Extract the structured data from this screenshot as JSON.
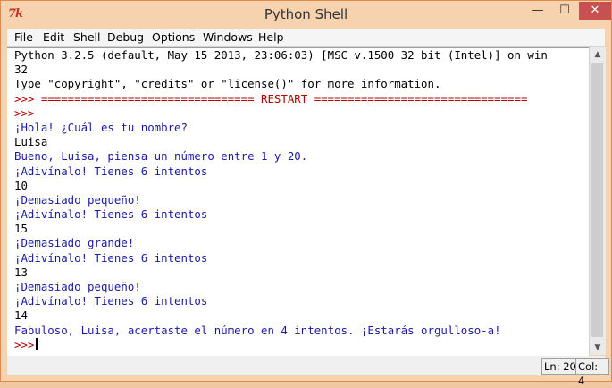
{
  "window": {
    "title": "Python Shell",
    "icon_text": "7k",
    "controls": {
      "minimize": "—",
      "maximize": "☐",
      "close": "✕"
    }
  },
  "menu": [
    "File",
    "Edit",
    "Shell",
    "Debug",
    "Options",
    "Windows",
    "Help"
  ],
  "shell_lines": [
    {
      "text": "Python 3.2.5 (default, May 15 2013, 23:06:03) [MSC v.1500 32 bit (Intel)] on win",
      "color": "black"
    },
    {
      "text": "32",
      "color": "black"
    },
    {
      "text": "Type \"copyright\", \"credits\" or \"license()\" for more information.",
      "color": "black"
    },
    {
      "text": ">>> ================================ RESTART ================================",
      "color": "red"
    },
    {
      "text": ">>>",
      "color": "red"
    },
    {
      "text": "¡Hola! ¿Cuál es tu nombre?",
      "color": "blue"
    },
    {
      "text": "Luisa",
      "color": "black"
    },
    {
      "text": "Bueno, Luisa, piensa un número entre 1 y 20.",
      "color": "blue"
    },
    {
      "text": "¡Adivínalo! Tienes 6 intentos",
      "color": "blue"
    },
    {
      "text": "10",
      "color": "black"
    },
    {
      "text": "¡Demasiado pequeño!",
      "color": "blue"
    },
    {
      "text": "¡Adivínalo! Tienes 6 intentos",
      "color": "blue"
    },
    {
      "text": "15",
      "color": "black"
    },
    {
      "text": "¡Demasiado grande!",
      "color": "blue"
    },
    {
      "text": "¡Adivínalo! Tienes 6 intentos",
      "color": "blue"
    },
    {
      "text": "13",
      "color": "black"
    },
    {
      "text": "¡Demasiado pequeño!",
      "color": "blue"
    },
    {
      "text": "¡Adivínalo! Tienes 6 intentos",
      "color": "blue"
    },
    {
      "text": "14",
      "color": "black"
    },
    {
      "text": "Fabuloso, Luisa, acertaste el número en 4 intentos. ¡Estarás orgulloso-a!",
      "color": "blue"
    }
  ],
  "prompt": ">>>",
  "scrollbar": {
    "up": "▲",
    "down": "▼"
  },
  "status": {
    "line": "Ln: 20",
    "col": "Col: 4"
  },
  "colors": {
    "black": "#000000",
    "blue": "#1a1aa6",
    "red": "#b30000"
  }
}
